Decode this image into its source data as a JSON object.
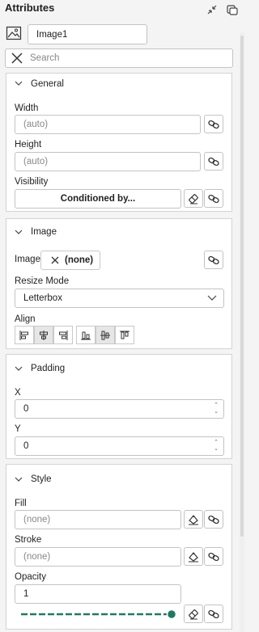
{
  "header": {
    "title": "Attributes"
  },
  "element": {
    "name": "Image1"
  },
  "search": {
    "placeholder": "Search"
  },
  "general": {
    "heading": "General",
    "width_label": "Width",
    "width_placeholder": "(auto)",
    "height_label": "Height",
    "height_placeholder": "(auto)",
    "visibility_label": "Visibility",
    "visibility_button": "Conditioned by..."
  },
  "image": {
    "heading": "Image",
    "image_label": "Image",
    "image_value": "(none)",
    "resize_label": "Resize Mode",
    "resize_value": "Letterbox",
    "align_label": "Align"
  },
  "padding": {
    "heading": "Padding",
    "x_label": "X",
    "x_value": "0",
    "y_label": "Y",
    "y_value": "0"
  },
  "style": {
    "heading": "Style",
    "fill_label": "Fill",
    "fill_placeholder": "(none)",
    "stroke_label": "Stroke",
    "stroke_placeholder": "(none)",
    "opacity_label": "Opacity",
    "opacity_value": "1",
    "opacity_level": 1.0,
    "accent_color": "#1f7a63"
  }
}
